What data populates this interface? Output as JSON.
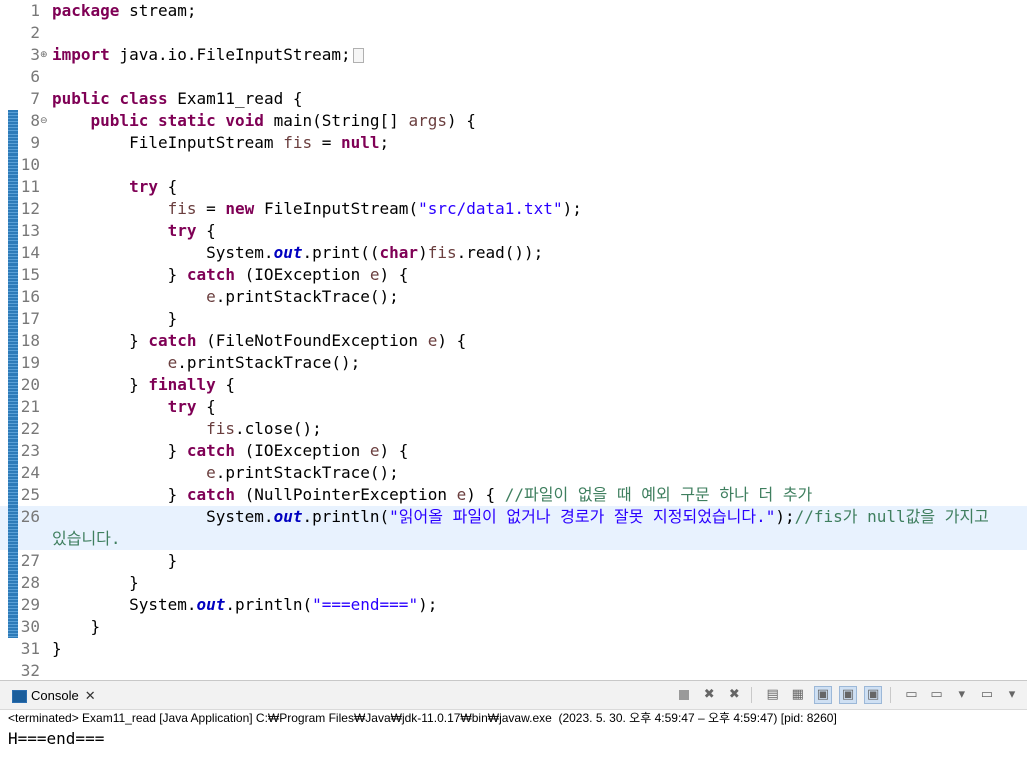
{
  "editor": {
    "lines": [
      {
        "n": "1",
        "parts": [
          [
            "kw",
            "package"
          ],
          [
            "p",
            " stream;"
          ]
        ]
      },
      {
        "n": "2",
        "parts": []
      },
      {
        "n": "3",
        "fold": "⊕",
        "parts": [
          [
            "kw",
            "import"
          ],
          [
            "p",
            " java.io.FileInputStream;"
          ],
          [
            "box",
            ""
          ]
        ]
      },
      {
        "n": "6",
        "parts": []
      },
      {
        "n": "7",
        "parts": [
          [
            "kw",
            "public"
          ],
          [
            "p",
            " "
          ],
          [
            "kw",
            "class"
          ],
          [
            "p",
            " Exam11_read {"
          ]
        ]
      },
      {
        "n": "8",
        "fold": "⊖",
        "bar": true,
        "parts": [
          [
            "p",
            "    "
          ],
          [
            "kw",
            "public"
          ],
          [
            "p",
            " "
          ],
          [
            "kw",
            "static"
          ],
          [
            "p",
            " "
          ],
          [
            "kw",
            "void"
          ],
          [
            "p",
            " main(String[] "
          ],
          [
            "var",
            "args"
          ],
          [
            "p",
            ") {"
          ]
        ]
      },
      {
        "n": "9",
        "bar": true,
        "parts": [
          [
            "p",
            "        FileInputStream "
          ],
          [
            "var",
            "fis"
          ],
          [
            "p",
            " = "
          ],
          [
            "kw",
            "null"
          ],
          [
            "p",
            ";"
          ]
        ]
      },
      {
        "n": "10",
        "bar": true,
        "parts": []
      },
      {
        "n": "11",
        "bar": true,
        "parts": [
          [
            "p",
            "        "
          ],
          [
            "kw",
            "try"
          ],
          [
            "p",
            " {"
          ]
        ]
      },
      {
        "n": "12",
        "bar": true,
        "parts": [
          [
            "p",
            "            "
          ],
          [
            "var",
            "fis"
          ],
          [
            "p",
            " = "
          ],
          [
            "kw",
            "new"
          ],
          [
            "p",
            " FileInputStream("
          ],
          [
            "str",
            "\"src/data1.txt\""
          ],
          [
            "p",
            ");"
          ]
        ]
      },
      {
        "n": "13",
        "bar": true,
        "parts": [
          [
            "p",
            "            "
          ],
          [
            "kw",
            "try"
          ],
          [
            "p",
            " {"
          ]
        ]
      },
      {
        "n": "14",
        "bar": true,
        "parts": [
          [
            "p",
            "                System."
          ],
          [
            "fld",
            "out"
          ],
          [
            "p",
            ".print(("
          ],
          [
            "kw",
            "char"
          ],
          [
            "p",
            ")"
          ],
          [
            "var",
            "fis"
          ],
          [
            "p",
            ".read());"
          ]
        ]
      },
      {
        "n": "15",
        "bar": true,
        "parts": [
          [
            "p",
            "            } "
          ],
          [
            "kw",
            "catch"
          ],
          [
            "p",
            " (IOException "
          ],
          [
            "var",
            "e"
          ],
          [
            "p",
            ") {"
          ]
        ]
      },
      {
        "n": "16",
        "bar": true,
        "parts": [
          [
            "p",
            "                "
          ],
          [
            "var",
            "e"
          ],
          [
            "p",
            ".printStackTrace();"
          ]
        ]
      },
      {
        "n": "17",
        "bar": true,
        "parts": [
          [
            "p",
            "            }"
          ]
        ]
      },
      {
        "n": "18",
        "bar": true,
        "parts": [
          [
            "p",
            "        } "
          ],
          [
            "kw",
            "catch"
          ],
          [
            "p",
            " (FileNotFoundException "
          ],
          [
            "var",
            "e"
          ],
          [
            "p",
            ") {"
          ]
        ]
      },
      {
        "n": "19",
        "bar": true,
        "parts": [
          [
            "p",
            "            "
          ],
          [
            "var",
            "e"
          ],
          [
            "p",
            ".printStackTrace();"
          ]
        ]
      },
      {
        "n": "20",
        "bar": true,
        "parts": [
          [
            "p",
            "        } "
          ],
          [
            "kw",
            "finally"
          ],
          [
            "p",
            " {"
          ]
        ]
      },
      {
        "n": "21",
        "bar": true,
        "parts": [
          [
            "p",
            "            "
          ],
          [
            "kw",
            "try"
          ],
          [
            "p",
            " {"
          ]
        ]
      },
      {
        "n": "22",
        "bar": true,
        "parts": [
          [
            "p",
            "                "
          ],
          [
            "var",
            "fis"
          ],
          [
            "p",
            ".close();"
          ]
        ]
      },
      {
        "n": "23",
        "bar": true,
        "parts": [
          [
            "p",
            "            } "
          ],
          [
            "kw",
            "catch"
          ],
          [
            "p",
            " (IOException "
          ],
          [
            "var",
            "e"
          ],
          [
            "p",
            ") {"
          ]
        ]
      },
      {
        "n": "24",
        "bar": true,
        "parts": [
          [
            "p",
            "                "
          ],
          [
            "var",
            "e"
          ],
          [
            "p",
            ".printStackTrace();"
          ]
        ]
      },
      {
        "n": "25",
        "bar": true,
        "parts": [
          [
            "p",
            "            } "
          ],
          [
            "kw",
            "catch"
          ],
          [
            "p",
            " (NullPointerException "
          ],
          [
            "var",
            "e"
          ],
          [
            "p",
            ") { "
          ],
          [
            "cmt",
            "//파일이 없을 때 예외 구문 하나 더 추가"
          ]
        ]
      },
      {
        "n": "26",
        "bar": true,
        "current": true,
        "wrap": true,
        "parts": [
          [
            "p",
            "                System."
          ],
          [
            "fld",
            "out"
          ],
          [
            "p",
            ".println("
          ],
          [
            "str",
            "\"읽어올 파일이 없거나 경로가 잘못 지정되었습니다.\""
          ],
          [
            "p",
            ");"
          ],
          [
            "cmt",
            "//fis가 null값을 가지고"
          ]
        ],
        "wrapParts": [
          [
            "cmt",
            "있습니다."
          ]
        ]
      },
      {
        "n": "27",
        "bar": true,
        "parts": [
          [
            "p",
            "            }"
          ]
        ]
      },
      {
        "n": "28",
        "bar": true,
        "parts": [
          [
            "p",
            "        }"
          ]
        ]
      },
      {
        "n": "29",
        "bar": true,
        "parts": [
          [
            "p",
            "        System."
          ],
          [
            "fld",
            "out"
          ],
          [
            "p",
            ".println("
          ],
          [
            "str",
            "\"===end===\""
          ],
          [
            "p",
            ");"
          ]
        ]
      },
      {
        "n": "30",
        "bar": true,
        "parts": [
          [
            "p",
            "    }"
          ]
        ]
      },
      {
        "n": "31",
        "parts": [
          [
            "p",
            "}"
          ]
        ]
      },
      {
        "n": "32",
        "parts": []
      }
    ]
  },
  "console": {
    "tab_label": "Console",
    "close_glyph": "✕",
    "status": "<terminated> Exam11_read [Java Application] C:₩Program Files₩Java₩jdk-11.0.17₩bin₩javaw.exe  (2023. 5. 30. 오후 4:59:47 – 오후 4:59:47) [pid: 8260]",
    "output": "H===end===",
    "toolbar_icons": [
      "terminate-icon",
      "remove-launch-icon",
      "remove-all-icon",
      "scroll-lock-icon",
      "word-wrap-icon",
      "show-stdout-icon",
      "show-stderr-icon",
      "pin-console-icon",
      "display-console-icon",
      "dropdown-icon",
      "open-console-icon",
      "dropdown-icon",
      "view-menu-icon"
    ]
  }
}
